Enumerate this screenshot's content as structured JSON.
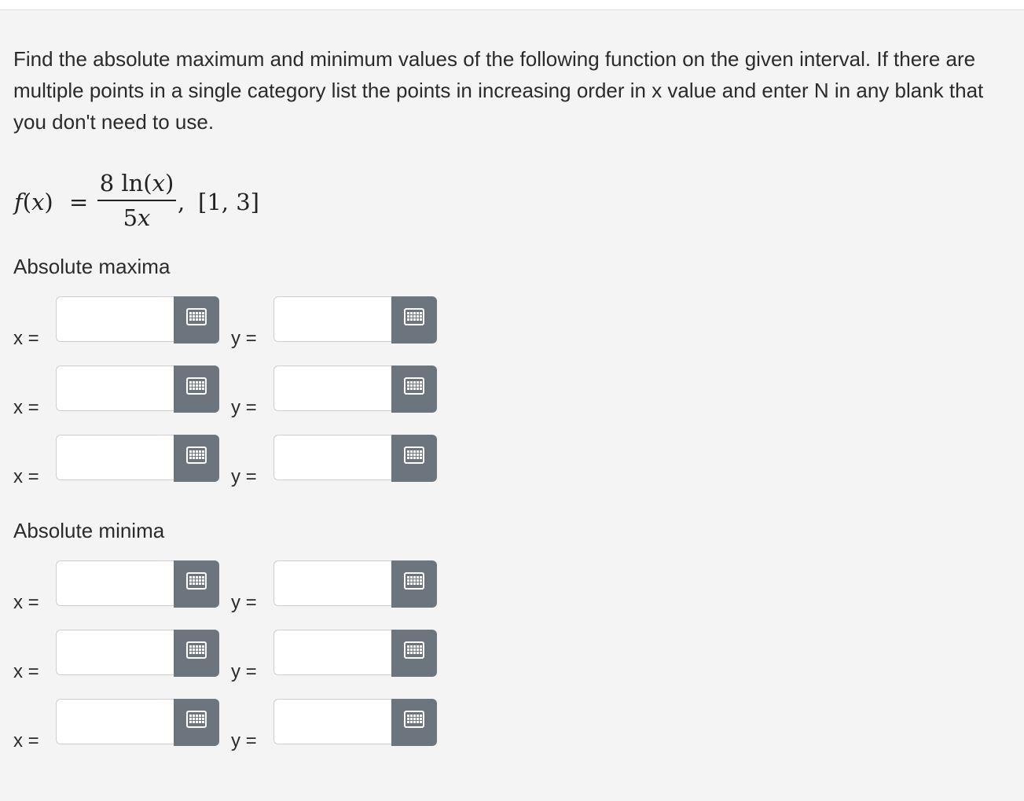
{
  "question": {
    "text": "Find the absolute maximum and minimum values of the following function on the given interval. If there are multiple points in a single category list the points in increasing order in x value and enter N in any blank that you don't need to use."
  },
  "formula": {
    "lhs_func": "f",
    "lhs_open": "(",
    "lhs_var": "x",
    "lhs_close": ")",
    "equals": "=",
    "numerator_coef": "8",
    "numerator_fn": " ln(",
    "numerator_var": "x",
    "numerator_close": ")",
    "denominator_coef": "5",
    "denominator_var": "x",
    "comma": ",",
    "interval": "[1, 3]"
  },
  "maxima": {
    "heading": "Absolute maxima",
    "rows": [
      {
        "x_label": "x =",
        "x_value": "",
        "y_label": "y =",
        "y_value": ""
      },
      {
        "x_label": "x =",
        "x_value": "",
        "y_label": "y =",
        "y_value": ""
      },
      {
        "x_label": "x =",
        "x_value": "",
        "y_label": "y =",
        "y_value": ""
      }
    ]
  },
  "minima": {
    "heading": "Absolute minima",
    "rows": [
      {
        "x_label": "x =",
        "x_value": "",
        "y_label": "y =",
        "y_value": ""
      },
      {
        "x_label": "x =",
        "x_value": "",
        "y_label": "y =",
        "y_value": ""
      },
      {
        "x_label": "x =",
        "x_value": "",
        "y_label": "y =",
        "y_value": ""
      }
    ]
  },
  "colors": {
    "panel_background": "#f4f4f4",
    "keyboard_button": "#6c757d",
    "input_background": "#ffffff"
  },
  "icons": {
    "keyboard_button": "keyboard-grid-icon"
  }
}
